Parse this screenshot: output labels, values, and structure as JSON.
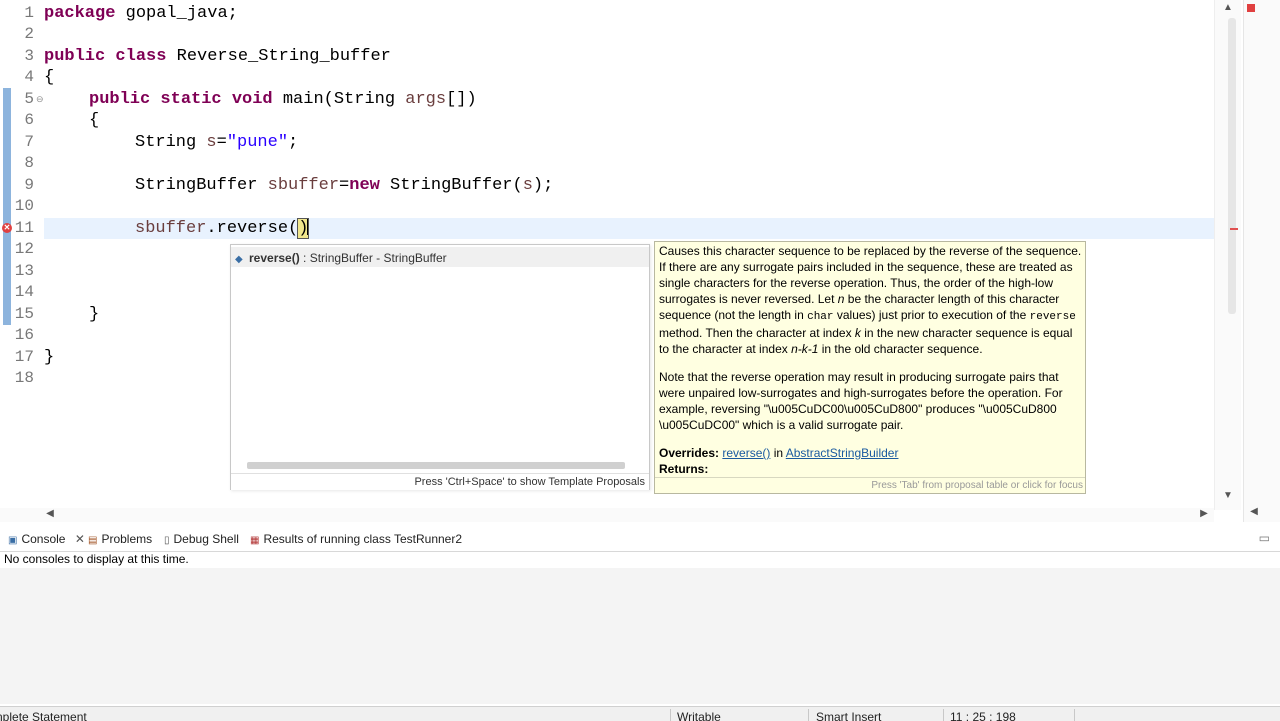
{
  "editor": {
    "lines": [
      {
        "num": "1"
      },
      {
        "num": "2"
      },
      {
        "num": "3"
      },
      {
        "num": "4"
      },
      {
        "num": "5"
      },
      {
        "num": "6"
      },
      {
        "num": "7"
      },
      {
        "num": "8"
      },
      {
        "num": "9"
      },
      {
        "num": "10"
      },
      {
        "num": "11"
      },
      {
        "num": "12"
      },
      {
        "num": "13"
      },
      {
        "num": "14"
      },
      {
        "num": "15"
      },
      {
        "num": "16"
      },
      {
        "num": "17"
      },
      {
        "num": "18"
      }
    ],
    "code": {
      "l1_kw": "package",
      "l1_rest": " gopal_java;",
      "l3_kw": "public class",
      "l3_rest": " Reverse_String_buffer",
      "l4": "{",
      "l5_kw": "public static void",
      "l5_rest": " main(String ",
      "l5_var": "args",
      "l5_end": "[])",
      "l6": "{",
      "l7_a": "String ",
      "l7_var": "s",
      "l7_eq": "=",
      "l7_str": "\"pune\"",
      "l7_end": ";",
      "l9_a": "StringBuffer ",
      "l9_var": "sbuffer",
      "l9_eq": "=",
      "l9_kw": "new",
      "l9_b": " StringBuffer(",
      "l9_var2": "s",
      "l9_end": ");",
      "l11_var": "sbuffer",
      "l11_mid": ".reverse(",
      "l11_br": ")",
      "l15": "}",
      "l17": "}"
    }
  },
  "completion": {
    "method": "reverse()",
    "signature": " : StringBuffer - StringBuffer",
    "hint": "Press 'Ctrl+Space' to show Template Proposals"
  },
  "javadoc": {
    "p1_a": "Causes this character sequence to be replaced by the reverse of the sequence. If there are any surrogate pairs included in the sequence, these are treated as single characters for the reverse operation. Thus, the order of the high-low surrogates is never reversed. Let ",
    "p1_n": "n",
    "p1_b": " be the character length of this character sequence (not the length in ",
    "p1_char": "char",
    "p1_c": " values) just prior to execution of the ",
    "p1_reverse": "reverse",
    "p1_d": " method. Then the character at index ",
    "p1_k": "k",
    "p1_e": " in the new character sequence is equal to the character at index ",
    "p1_nk": "n-k-1",
    "p1_f": " in the old character sequence.",
    "p2": "Note that the reverse operation may result in producing surrogate pairs that were unpaired low-surrogates and high-surrogates before the operation. For example, reversing \"\\u005CuDC00\\u005CuD800\" produces \"\\u005CuD800 \\u005CuDC00\" which is a valid surrogate pair.",
    "overrides_label": "Overrides:",
    "overrides_method": "reverse()",
    "overrides_in": " in ",
    "overrides_class": "AbstractStringBuilder",
    "returns_label": "Returns:",
    "footer_hint": "Press 'Tab' from proposal table or click for focus"
  },
  "panel": {
    "tabs": [
      {
        "label": "Console",
        "icon": "console-icon"
      },
      {
        "label": "Problems",
        "icon": "problems-icon"
      },
      {
        "label": "Debug Shell",
        "icon": "debug-shell-icon"
      },
      {
        "label": "Results of running class TestRunner2",
        "icon": "junit-icon"
      }
    ],
    "message": "No consoles to display at this time."
  },
  "status": {
    "left": "nplete Statement",
    "writable": "Writable",
    "insert_mode": "Smart Insert",
    "position": "11 : 25 : 198"
  },
  "colors": {
    "keyword": "#7f0055",
    "string": "#2a00ff",
    "variable": "#6a3e3e",
    "current_line": "#e8f2fe",
    "javadoc_bg": "#ffffe1"
  }
}
